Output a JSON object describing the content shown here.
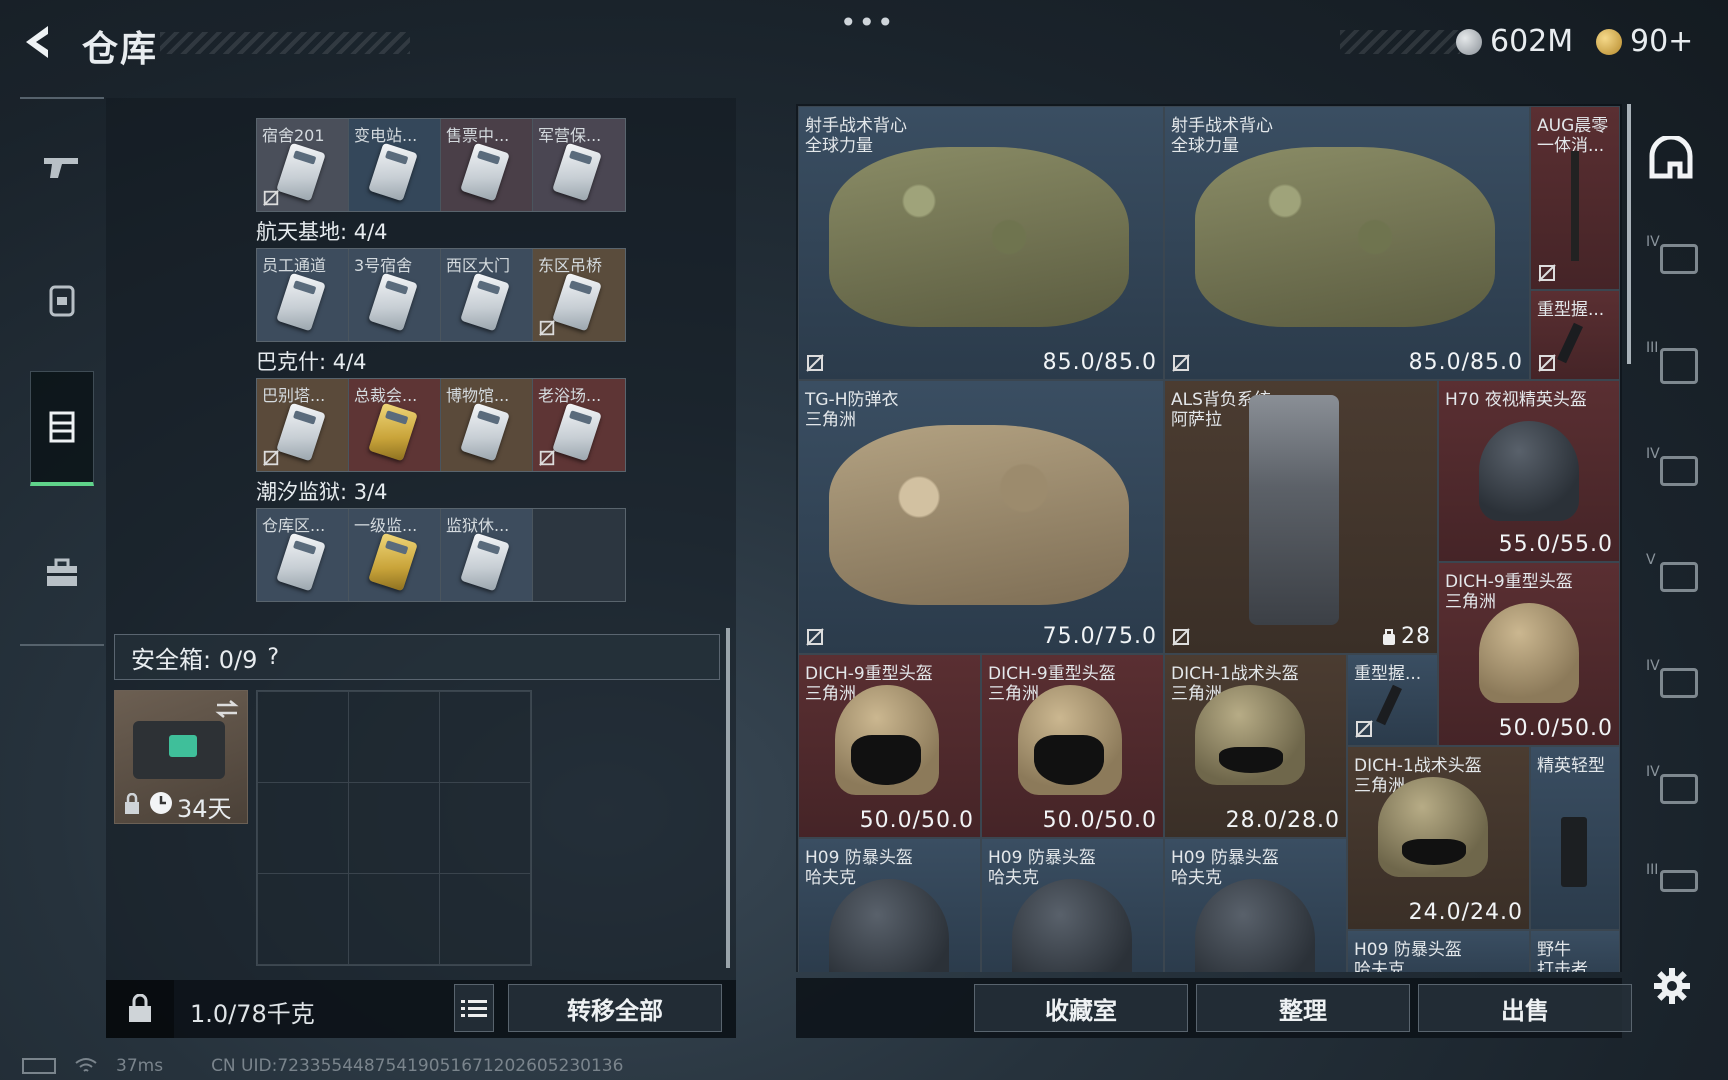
{
  "header": {
    "title": "仓库",
    "currency_silver": "602M",
    "currency_gold": "90+",
    "accent_green": "#5fd38a"
  },
  "left_nav": [
    "gun-icon",
    "backpack-icon",
    "container-icon",
    "case-icon"
  ],
  "key_groups": [
    {
      "label": null,
      "cards": [
        "宿舍201",
        "变电站...",
        "售票中...",
        "军营保..."
      ]
    },
    {
      "label": "航天基地: 4/4",
      "cards": [
        "员工通道",
        "3号宿舍",
        "西区大门",
        "东区吊桥"
      ]
    },
    {
      "label": "巴克什: 4/4",
      "cards": [
        "巴别塔...",
        "总裁会...",
        "博物馆...",
        "老浴场..."
      ]
    },
    {
      "label": "潮汐监狱: 3/4",
      "cards": [
        "仓库区...",
        "一级监...",
        "监狱休..."
      ]
    }
  ],
  "safebox": {
    "label": "安全箱: 0/9",
    "help": "?",
    "item_timer": "34天"
  },
  "footer_left": {
    "weight": "1.0/78千克",
    "transfer_all": "转移全部"
  },
  "footer_right": {
    "collection": "收藏室",
    "organize": "整理",
    "sell": "出售"
  },
  "items": {
    "vest1": {
      "name": "射手战术背心",
      "sub": "全球力量",
      "dur": "85.0/85.0"
    },
    "vest2": {
      "name": "射手战术背心",
      "sub": "全球力量",
      "dur": "85.0/85.0"
    },
    "aug": {
      "name": "AUG晨零",
      "sub": "一体消..."
    },
    "grip1": {
      "name": "重型握..."
    },
    "tgh": {
      "name": "TG-H防弹衣",
      "sub": "三角洲",
      "dur": "75.0/75.0"
    },
    "als": {
      "name": "ALS背负系统",
      "sub": "阿萨拉",
      "cap": "28"
    },
    "h70": {
      "name": "H70 夜视精英头盔",
      "dur": "55.0/55.0"
    },
    "dich9a": {
      "name": "DICH-9重型头盔",
      "sub": "三角洲",
      "dur": "50.0/50.0"
    },
    "dich9b": {
      "name": "DICH-9重型头盔",
      "sub": "三角洲",
      "dur": "50.0/50.0"
    },
    "dich9c": {
      "name": "DICH-9重型头盔",
      "sub": "三角洲",
      "dur": "50.0/50.0"
    },
    "dich1a": {
      "name": "DICH-1战术头盔",
      "sub": "三角洲",
      "dur": "28.0/28.0"
    },
    "grip2": {
      "name": "重型握..."
    },
    "dich1b": {
      "name": "DICH-1战术头盔",
      "sub": "三角洲",
      "dur": "24.0/24.0"
    },
    "elite": {
      "name": "精英轻型"
    },
    "h09a": {
      "name": "H09 防暴头盔",
      "sub": "哈夫克"
    },
    "h09b": {
      "name": "H09 防暴头盔",
      "sub": "哈夫克"
    },
    "h09c": {
      "name": "H09 防暴头盔",
      "sub": "哈夫克"
    },
    "h09d": {
      "name": "H09 防暴头盔",
      "sub": "哈夫克"
    },
    "bison": {
      "name": "野牛",
      "sub": "打击者..."
    }
  },
  "right_nav": [
    "helmet-tab-icon",
    "IV",
    "III",
    "IV",
    "V",
    "IV",
    "IV",
    "III"
  ],
  "status": {
    "ping": "37ms",
    "uid": "CN UID:7233554487541905167120260523013​6"
  }
}
